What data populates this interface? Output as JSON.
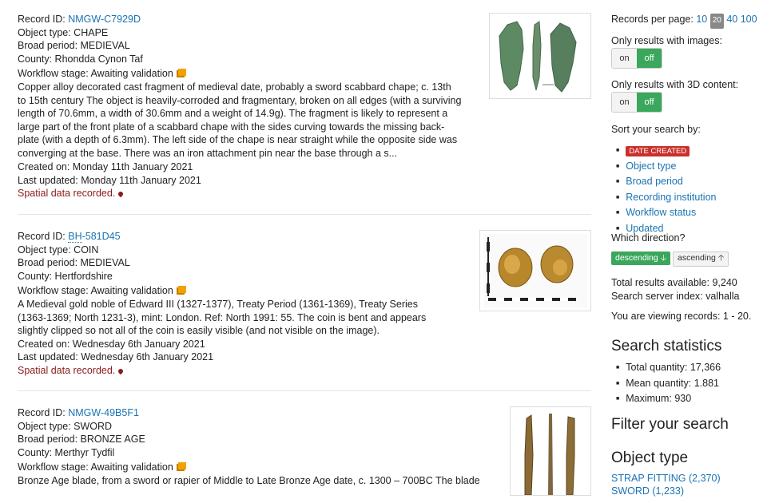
{
  "records": [
    {
      "id_label": "Record ID:",
      "id": "NMGW-C7929D",
      "object_type": "Object type: CHAPE",
      "period": "Broad period: MEDIEVAL",
      "county": "County: Rhondda Cynon Taf",
      "workflow": "Workflow stage: Awaiting validation",
      "description": "Copper alloy decorated cast fragment of medieval date, probably a sword scabbard chape; c. 13th to 15th century The object is heavily-corroded and fragmentary, broken on all edges (with a surviving length of 70.6mm, a width of 30.6mm and a weight of 14.9g).  The fragment is likely to represent a large part of the front plate of a scabbard chape with the sides curving towards the missing back-plate (with a depth of 6.3mm).  The left side of the chape is near straight while the opposite side was converging at the base. There was an iron attachment pin near the base through a s...",
      "created": "Created on: Monday 11th January 2021",
      "updated": "Last updated: Monday 11th January 2021",
      "spatial": "Spatial data recorded."
    },
    {
      "id_label": "Record ID:",
      "id_abbr": "BH",
      "id_rest": "-581D45",
      "object_type": "Object type: COIN",
      "period": "Broad period: MEDIEVAL",
      "county": "County: Hertfordshire",
      "workflow": "Workflow stage: Awaiting validation",
      "description": "A Medieval gold noble of Edward III (1327-1377), Treaty Period (1361-1369), Treaty Series (1363-1369; North 1231-3), mint: London. Ref: North 1991: 55. The coin is bent and appears slightly clipped so not all of the coin is easily visible (and not visible on the image).",
      "created": "Created on: Wednesday 6th January 2021",
      "updated": "Last updated: Wednesday 6th January 2021",
      "spatial": "Spatial data recorded."
    },
    {
      "id_label": "Record ID:",
      "id": "NMGW-49B5F1",
      "object_type": "Object type: SWORD",
      "period": "Broad period: BRONZE AGE",
      "county": "County: Merthyr Tydfil",
      "workflow": "Workflow stage: Awaiting validation",
      "description": "Bronze Age blade, from a sword or rapier of Middle to Late Bronze Age date, c. 1300 – 700BC The blade"
    }
  ],
  "sidebar": {
    "records_per_page_label": "Records per page:",
    "per_page": [
      "10",
      "20",
      "40",
      "100"
    ],
    "images_label": "Only results with images:",
    "threeD_label": "Only results with 3D content:",
    "toggle_on": "on",
    "toggle_off": "off",
    "sort_label": "Sort your search by:",
    "sort_items": [
      "DATE CREATED",
      "Object type",
      "Broad period",
      "Recording institution",
      "Workflow status",
      "Updated"
    ],
    "direction_label": "Which direction?",
    "descending": "descending",
    "ascending": "ascending",
    "total_results": "Total results available: 9,240",
    "server_index": "Search server index: valhalla",
    "viewing": "You are viewing records: 1 - 20.",
    "stats_heading": "Search statistics",
    "stats": [
      "Total quantity: 17,366",
      "Mean quantity: 1.881",
      "Maximum: 930"
    ],
    "filter_heading": "Filter your search",
    "object_type_heading": "Object type",
    "facets": [
      "STRAP FITTING (2,370)",
      "SWORD (1,233)"
    ]
  },
  "colors": {
    "link": "#1a73b3",
    "toggle_active": "#3ba75c",
    "badge": "#c9302c",
    "spatial": "#8b1a1a",
    "workflow_flag": "#f3a100"
  },
  "icons": [
    "workflow-flag-icon",
    "map-pin-icon",
    "arrow-down-icon",
    "arrow-up-icon"
  ]
}
